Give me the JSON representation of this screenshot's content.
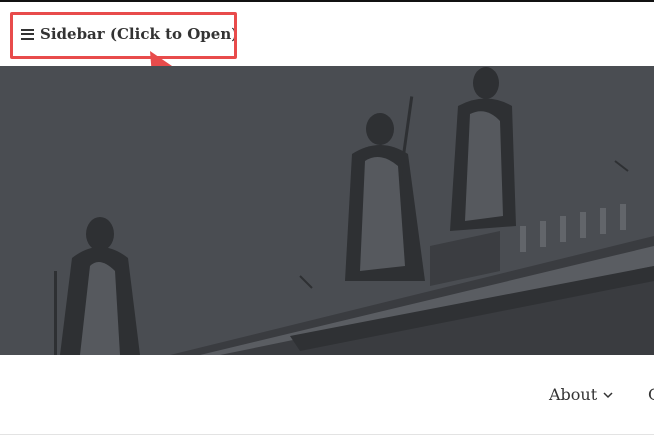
{
  "header": {
    "sidebar_toggle_label": "Sidebar (Click to Open)",
    "icon": "hamburger-menu-icon"
  },
  "annotation": {
    "color": "#e84b4b"
  },
  "hero": {
    "overlay_color": "#4a4d52"
  },
  "nav": {
    "items": [
      {
        "label": "About",
        "icon": "chevron-down-icon"
      },
      {
        "label": "C"
      }
    ]
  }
}
